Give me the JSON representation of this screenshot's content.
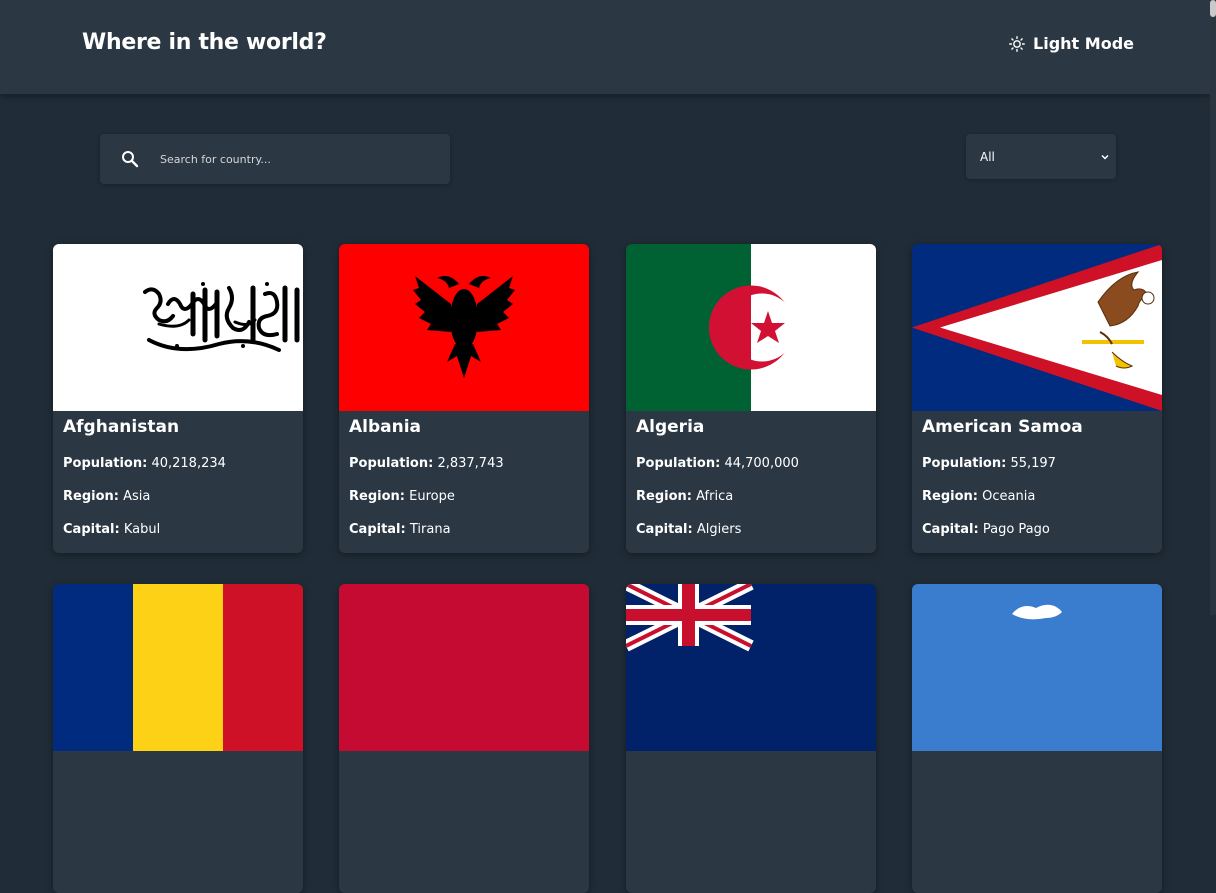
{
  "header": {
    "title": "Where in the world?",
    "mode_label": "Light Mode",
    "mode_icon": "sun-icon"
  },
  "search": {
    "placeholder": "Search for country...",
    "value": "",
    "icon": "search-icon"
  },
  "filter": {
    "selected": "All",
    "icon": "chevron-down-icon"
  },
  "labels": {
    "population": "Population:",
    "region": "Region:",
    "capital": "Capital:"
  },
  "countries": [
    {
      "name": "Afghanistan",
      "population": "40,218,234",
      "region": "Asia",
      "capital": "Kabul"
    },
    {
      "name": "Albania",
      "population": "2,837,743",
      "region": "Europe",
      "capital": "Tirana"
    },
    {
      "name": "Algeria",
      "population": "44,700,000",
      "region": "Africa",
      "capital": "Algiers"
    },
    {
      "name": "American Samoa",
      "population": "55,197",
      "region": "Oceania",
      "capital": "Pago Pago"
    }
  ],
  "colors": {
    "background": "#202c37",
    "element": "#2b3743",
    "text": "#ffffff"
  }
}
